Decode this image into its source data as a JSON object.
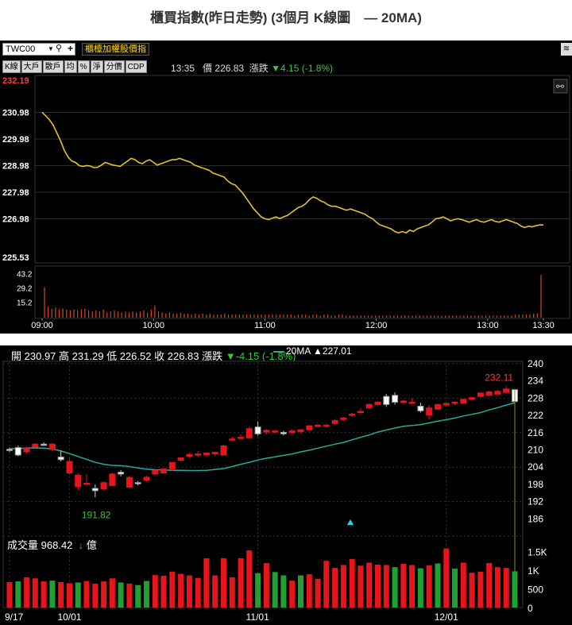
{
  "page_title": "櫃買指數(昨日走勢) (3個月 K線圖　— 20MA)",
  "intraday": {
    "symbol": "TWC00",
    "index_name": "櫃檯加權股價指",
    "right_button": "≋",
    "buttons": [
      "K線",
      "大戶",
      "散戶",
      "均",
      "%",
      "淨",
      "分價",
      "CDP"
    ],
    "time": "13:35",
    "price_label": "價",
    "price": "226.83",
    "change_label": "漲跌",
    "change": "▼4.15 (-1.8%)"
  },
  "daily": {
    "open_label": "開",
    "open": "230.97",
    "high_label": "高",
    "high": "231.29",
    "low_label": "低",
    "low": "226.52",
    "close_label": "收",
    "close": "226.83",
    "change_label": "漲跌",
    "change": "▼-4.15 (-1.8%)",
    "ma_label": "20MA",
    "ma_value": "▲227.01",
    "volume_label": "成交量",
    "volume_value": "968.42",
    "volume_arrow": "↓",
    "volume_unit": "億"
  },
  "colors": {
    "price_line": "#e6c229",
    "volume_bar": "#d24a1e",
    "up_candle": "#ffffff",
    "down_candle": "#e8141c",
    "ma_line": "#2aa8a0",
    "volume_up": "#20a030",
    "volume_down": "#e8141c",
    "panel_bg": "#000000",
    "label_red": "#ff3b3b",
    "label_green": "#40c040"
  },
  "chart_data": [
    {
      "type": "line",
      "ylim": [
        225.53,
        232.19
      ],
      "y_ticks": [
        "232.19",
        "230.98",
        "229.98",
        "228.98",
        "227.98",
        "226.98",
        "225.53"
      ],
      "x_ticks": [
        "09:00",
        "10:00",
        "11:00",
        "12:00",
        "13:00",
        "13:30"
      ],
      "x": [
        0,
        2,
        4,
        6,
        8,
        10,
        12,
        14,
        16,
        18,
        20,
        22,
        24,
        26,
        28,
        30,
        32,
        34,
        36,
        38,
        40,
        42,
        44,
        46,
        48,
        50,
        52,
        54,
        56,
        58,
        60,
        62,
        64,
        66,
        68,
        70,
        72,
        74,
        76,
        78,
        80,
        82,
        84,
        86,
        88,
        90,
        92,
        94,
        96,
        98,
        100,
        102,
        104,
        106,
        108,
        110,
        112,
        114,
        116,
        118,
        120,
        122,
        124,
        126,
        128,
        130,
        132,
        134,
        136,
        138,
        140,
        142,
        144,
        146,
        148,
        150,
        152,
        154,
        156,
        158,
        160,
        162,
        164,
        166,
        168,
        170,
        172,
        174,
        176,
        178,
        180,
        182,
        184,
        186,
        188,
        190,
        192,
        194,
        196,
        198,
        200,
        202,
        204,
        206,
        208,
        210,
        212,
        214,
        216,
        218,
        220,
        222,
        224,
        226,
        228,
        230,
        232,
        234,
        236,
        238,
        240,
        242,
        244,
        246,
        248,
        250,
        252,
        254,
        256,
        258,
        260,
        262,
        264,
        266,
        268,
        270
      ],
      "series": [
        {
          "name": "",
          "values": [
            230.98,
            230.85,
            230.7,
            230.5,
            230.2,
            229.9,
            229.55,
            229.3,
            229.15,
            229.1,
            228.98,
            228.95,
            228.98,
            228.96,
            228.9,
            228.92,
            229.0,
            229.1,
            229.05,
            229.0,
            228.98,
            228.95,
            229.05,
            229.15,
            229.25,
            229.2,
            229.1,
            229.05,
            229.15,
            229.2,
            229.1,
            229.0,
            229.05,
            229.1,
            229.15,
            229.2,
            229.2,
            229.25,
            229.2,
            229.15,
            229.1,
            229.0,
            228.95,
            228.9,
            228.85,
            228.8,
            228.7,
            228.65,
            228.6,
            228.55,
            228.4,
            228.3,
            228.25,
            228.1,
            227.95,
            227.75,
            227.55,
            227.35,
            227.2,
            227.05,
            226.98,
            226.95,
            227.0,
            227.05,
            226.98,
            227.05,
            227.1,
            227.2,
            227.3,
            227.4,
            227.45,
            227.55,
            227.7,
            227.8,
            227.75,
            227.65,
            227.6,
            227.5,
            227.45,
            227.45,
            227.4,
            227.35,
            227.3,
            227.35,
            227.3,
            227.25,
            227.2,
            227.15,
            227.05,
            226.98,
            226.85,
            226.75,
            226.7,
            226.65,
            226.6,
            226.5,
            226.45,
            226.5,
            226.45,
            226.55,
            226.5,
            226.6,
            226.65,
            226.7,
            226.75,
            226.85,
            226.98,
            227.0,
            227.05,
            226.98,
            226.9,
            226.95,
            226.98,
            226.95,
            226.9,
            226.85,
            226.9,
            226.95,
            226.88,
            226.85,
            226.9,
            226.95,
            226.88,
            226.85,
            226.9,
            226.95,
            226.9,
            226.85,
            226.8,
            226.7,
            226.65,
            226.7,
            226.68,
            226.72,
            226.75,
            226.75
          ]
        }
      ]
    },
    {
      "type": "bar",
      "name": "intraday volume",
      "ylim": [
        0,
        46
      ],
      "y_ticks": [
        "43.2",
        "29.2",
        "15.2"
      ],
      "values": [
        30,
        11,
        9,
        10,
        8,
        9,
        8,
        7,
        8,
        7,
        8,
        9,
        7,
        6,
        7,
        6,
        8,
        5,
        6,
        7,
        6,
        5,
        6,
        5,
        6,
        5,
        6,
        7,
        5,
        8,
        12,
        6,
        5,
        4,
        5,
        4,
        4,
        5,
        4,
        4,
        3,
        4,
        3,
        4,
        3,
        4,
        3,
        3,
        3,
        4,
        3,
        3,
        3,
        3,
        3,
        3,
        3,
        3,
        3,
        3,
        3,
        3,
        3,
        3,
        3,
        3,
        3,
        3,
        2,
        3,
        3,
        3,
        2,
        3,
        3,
        2,
        3,
        3,
        2,
        2,
        3,
        3,
        2,
        2,
        2,
        2,
        2,
        2,
        2,
        2,
        2,
        2,
        2,
        2,
        2,
        2,
        2,
        2,
        2,
        2,
        2,
        2,
        2,
        2,
        2,
        2,
        2,
        2,
        2,
        2,
        2,
        2,
        2,
        2,
        2,
        2,
        2,
        2,
        2,
        2,
        2,
        2,
        2,
        2,
        2,
        2,
        2,
        2,
        3,
        3,
        3,
        3,
        3,
        4,
        4,
        42
      ]
    },
    {
      "type": "candlestick",
      "ylim": [
        180,
        240
      ],
      "y_ticks": [
        "240",
        "234",
        "228",
        "222",
        "216",
        "210",
        "204",
        "198",
        "192",
        "186"
      ],
      "x_ticks": [
        "9/17",
        "10/01",
        "11/01",
        "12/01"
      ],
      "annotations": [
        "191.82",
        "232.11"
      ],
      "ohlc": [
        [
          210.2,
          210.8,
          209.2,
          209.8
        ],
        [
          210.8,
          211.5,
          207.8,
          208.2
        ],
        [
          209.3,
          211.2,
          208.6,
          210.5
        ],
        [
          211.0,
          212.3,
          210.6,
          212.0
        ],
        [
          212.0,
          212.6,
          211.4,
          211.8
        ],
        [
          210.2,
          212.5,
          209.5,
          212.0
        ],
        [
          207.5,
          209.8,
          206.0,
          206.6
        ],
        [
          202.0,
          207.0,
          201.5,
          206.0
        ],
        [
          197.2,
          202.0,
          196.0,
          201.2
        ],
        [
          198.2,
          201.6,
          197.8,
          198.4
        ],
        [
          196.6,
          198.0,
          193.5,
          195.8
        ],
        [
          196.4,
          198.9,
          196.0,
          198.6
        ],
        [
          197.6,
          202.0,
          197.4,
          201.6
        ],
        [
          202.2,
          203.0,
          200.8,
          201.6
        ],
        [
          197.0,
          201.0,
          196.7,
          200.4
        ],
        [
          198.6,
          199.2,
          197.6,
          198.2
        ],
        [
          199.4,
          201.0,
          199.0,
          200.5
        ],
        [
          201.6,
          203.2,
          201.4,
          202.8
        ],
        [
          202.0,
          203.6,
          201.8,
          203.4
        ],
        [
          203.4,
          204.6,
          202.6,
          205.6
        ],
        [
          206.4,
          207.4,
          206.0,
          207.2
        ],
        [
          207.8,
          209.0,
          207.2,
          208.4
        ],
        [
          208.2,
          209.6,
          207.6,
          208.6
        ],
        [
          208.3,
          209.2,
          207.6,
          208.9
        ],
        [
          208.6,
          209.4,
          208.0,
          209.2
        ],
        [
          208.2,
          211.8,
          208.0,
          211.4
        ],
        [
          213.8,
          214.6,
          213.4,
          213.8
        ],
        [
          214.2,
          215.4,
          213.8,
          214.4
        ],
        [
          214.2,
          218.2,
          213.8,
          217.4
        ],
        [
          218.0,
          219.8,
          215.0,
          215.6
        ],
        [
          216.2,
          217.2,
          215.4,
          216.8
        ],
        [
          216.2,
          217.0,
          215.8,
          216.6
        ],
        [
          216.1,
          216.6,
          215.0,
          215.6
        ],
        [
          216.0,
          217.2,
          215.8,
          216.6
        ],
        [
          216.4,
          217.2,
          215.8,
          217.0
        ],
        [
          217.0,
          218.6,
          216.6,
          218.4
        ],
        [
          218.2,
          219.0,
          217.8,
          218.6
        ],
        [
          218.2,
          219.2,
          217.8,
          218.6
        ],
        [
          219.2,
          220.8,
          218.8,
          220.2
        ],
        [
          220.6,
          221.5,
          220.0,
          221.1
        ],
        [
          222.0,
          222.9,
          221.5,
          222.5
        ],
        [
          223.0,
          224.6,
          222.6,
          223.4
        ],
        [
          224.6,
          226.2,
          224.3,
          225.8
        ],
        [
          225.8,
          227.0,
          225.4,
          226.6
        ],
        [
          228.6,
          229.4,
          225.0,
          225.8
        ],
        [
          229.0,
          230.0,
          225.8,
          226.6
        ],
        [
          226.6,
          227.4,
          225.8,
          227.0
        ],
        [
          226.4,
          228.0,
          226.0,
          226.6
        ],
        [
          225.2,
          226.4,
          223.0,
          223.6
        ],
        [
          222.2,
          225.6,
          220.6,
          224.6
        ],
        [
          224.2,
          226.2,
          224.0,
          225.8
        ],
        [
          225.6,
          226.4,
          225.4,
          226.2
        ],
        [
          226.2,
          227.0,
          225.6,
          226.6
        ],
        [
          226.2,
          227.8,
          226.0,
          227.6
        ],
        [
          227.6,
          228.4,
          227.2,
          228.2
        ],
        [
          228.6,
          230.1,
          228.3,
          229.8
        ],
        [
          229.0,
          230.6,
          228.6,
          230.2
        ],
        [
          229.4,
          230.9,
          229.2,
          230.4
        ],
        [
          230.0,
          232.1,
          229.8,
          231.2
        ],
        [
          230.97,
          231.29,
          226.52,
          226.83
        ]
      ],
      "ma20": [
        210.4,
        210.5,
        210.6,
        210.7,
        210.6,
        210.3,
        209.6,
        208.7,
        207.7,
        206.7,
        205.7,
        205.0,
        204.6,
        204.5,
        204.2,
        203.7,
        203.3,
        203.1,
        203.0,
        202.9,
        202.9,
        202.8,
        202.8,
        202.9,
        203.2,
        203.5,
        204.2,
        205.0,
        205.7,
        206.5,
        207.1,
        207.6,
        208.1,
        208.6,
        209.3,
        209.9,
        210.6,
        211.3,
        212.0,
        212.6,
        213.5,
        214.4,
        215.2,
        216.2,
        216.9,
        217.6,
        218.2,
        218.5,
        218.8,
        219.4,
        220.0,
        220.5,
        221.1,
        221.8,
        222.4,
        223.0,
        223.9,
        224.7,
        225.6,
        226.4
      ]
    },
    {
      "type": "bar",
      "name": "成交量",
      "ylim": [
        0,
        1700
      ],
      "y_ticks": [
        "1.5K",
        "1K",
        "500",
        "0"
      ],
      "values": [
        680,
        700,
        810,
        780,
        700,
        720,
        680,
        650,
        670,
        710,
        640,
        700,
        780,
        670,
        640,
        600,
        710,
        870,
        850,
        960,
        900,
        860,
        790,
        1320,
        860,
        1320,
        810,
        1320,
        1530,
        920,
        1190,
        950,
        860,
        720,
        860,
        890,
        770,
        1250,
        1060,
        1140,
        1300,
        1120,
        1200,
        1150,
        1140,
        1080,
        1170,
        1140,
        1050,
        1130,
        1180,
        1580,
        1040,
        1200,
        930,
        960,
        1190,
        1080,
        1060,
        968
      ],
      "colors": [
        "down",
        "up",
        "down",
        "down",
        "down",
        "up",
        "down",
        "down",
        "up",
        "down",
        "down",
        "down",
        "down",
        "up",
        "down",
        "up",
        "up",
        "down",
        "down",
        "down",
        "down",
        "down",
        "down",
        "down",
        "down",
        "down",
        "down",
        "down",
        "down",
        "up",
        "down",
        "up",
        "up",
        "down",
        "up",
        "down",
        "down",
        "down",
        "down",
        "down",
        "down",
        "down",
        "down",
        "down",
        "down",
        "up",
        "down",
        "down",
        "up",
        "down",
        "up",
        "down",
        "up",
        "down",
        "down",
        "down",
        "down",
        "down",
        "down",
        "up"
      ]
    }
  ]
}
